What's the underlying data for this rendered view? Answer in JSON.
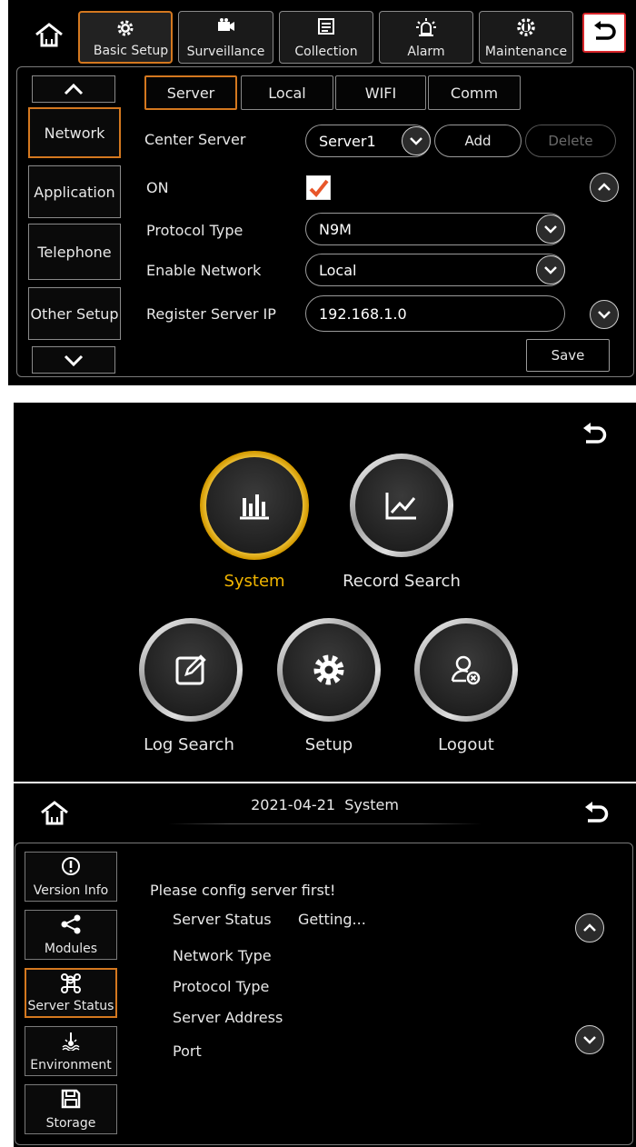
{
  "panel1": {
    "topbar": {
      "tabs": [
        {
          "label": "Basic Setup",
          "icon": "gear-icon"
        },
        {
          "label": "Surveillance",
          "icon": "camera-icon"
        },
        {
          "label": "Collection",
          "icon": "document-icon"
        },
        {
          "label": "Alarm",
          "icon": "alarm-light-icon"
        },
        {
          "label": "Maintenance",
          "icon": "maintenance-gear-icon"
        }
      ]
    },
    "sidebar": {
      "items": [
        {
          "label": "Network"
        },
        {
          "label": "Application"
        },
        {
          "label": "Telephone"
        },
        {
          "label": "Other Setup"
        }
      ]
    },
    "subtabs": [
      {
        "label": "Server"
      },
      {
        "label": "Local"
      },
      {
        "label": "WIFI"
      },
      {
        "label": "Comm"
      }
    ],
    "form": {
      "center_server_label": "Center Server",
      "center_server_value": "Server1",
      "add_label": "Add",
      "delete_label": "Delete",
      "on_label": "ON",
      "protocol_type_label": "Protocol Type",
      "protocol_type_value": "N9M",
      "enable_network_label": "Enable Network",
      "enable_network_value": "Local",
      "register_ip_label": "Register Server IP",
      "register_ip_value": "192.168.1.0",
      "save_label": "Save"
    },
    "colors": {
      "accent": "#d4781f",
      "check": "#e8562a",
      "return_border": "#d9262b"
    }
  },
  "panel2": {
    "menu": [
      {
        "label": "System",
        "icon": "bar-chart-icon"
      },
      {
        "label": "Record Search",
        "icon": "line-chart-icon"
      },
      {
        "label": "Log Search",
        "icon": "edit-icon"
      },
      {
        "label": "Setup",
        "icon": "gear-icon"
      },
      {
        "label": "Logout",
        "icon": "logout-user-icon"
      }
    ],
    "colors": {
      "selected": "#f2b600"
    }
  },
  "panel3": {
    "header": {
      "date": "2021-04-21",
      "title": "System"
    },
    "sidebar": {
      "items": [
        {
          "label": "Version Info",
          "icon": "info-icon"
        },
        {
          "label": "Modules",
          "icon": "share-icon"
        },
        {
          "label": "Server Status",
          "icon": "command-icon"
        },
        {
          "label": "Environment",
          "icon": "environment-icon"
        },
        {
          "label": "Storage",
          "icon": "save-disk-icon"
        }
      ]
    },
    "content": {
      "message": "Please config server first!",
      "rows": [
        {
          "label": "Server Status",
          "value": "Getting..."
        },
        {
          "label": "Network Type",
          "value": ""
        },
        {
          "label": "Protocol Type",
          "value": ""
        },
        {
          "label": "Server Address",
          "value": ""
        },
        {
          "label": "Port",
          "value": ""
        }
      ]
    }
  }
}
